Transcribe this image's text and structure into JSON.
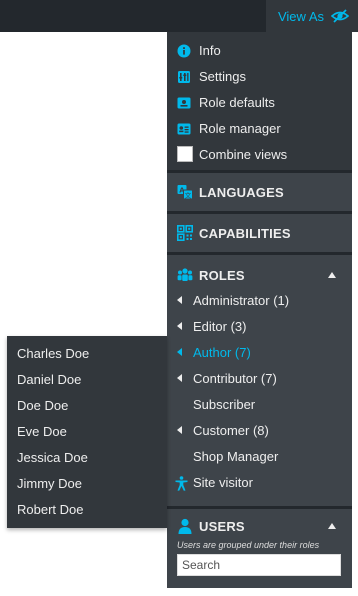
{
  "topbar": {
    "view_as_label": "View As",
    "view_as_icon": "eye-slash-icon",
    "accent": "#00b9eb"
  },
  "menu": {
    "items": [
      {
        "label": "Info",
        "icon": "info-icon"
      },
      {
        "label": "Settings",
        "icon": "settings-icon"
      },
      {
        "label": "Role defaults",
        "icon": "id-card-icon"
      },
      {
        "label": "Role manager",
        "icon": "id-card-alt-icon"
      },
      {
        "label": "Combine views",
        "icon": "checkbox"
      }
    ]
  },
  "sections": {
    "languages": {
      "title": "LANGUAGES",
      "icon": "translation-icon"
    },
    "capabilities": {
      "title": "CAPABILITIES",
      "icon": "capabilities-icon"
    },
    "roles": {
      "title": "ROLES",
      "icon": "groups-icon",
      "items": [
        {
          "label": "Administrator (1)",
          "has_arrow": true
        },
        {
          "label": "Editor (3)",
          "has_arrow": true
        },
        {
          "label": "Author (7)",
          "has_arrow": true,
          "active": true
        },
        {
          "label": "Contributor (7)",
          "has_arrow": true
        },
        {
          "label": "Subscriber",
          "has_arrow": false
        },
        {
          "label": "Customer (8)",
          "has_arrow": true
        },
        {
          "label": "Shop Manager",
          "has_arrow": false
        },
        {
          "label": "Site visitor",
          "icon": "universal-access-icon"
        }
      ]
    },
    "users": {
      "title": "USERS",
      "icon": "user-icon",
      "note": "Users are grouped under their roles",
      "search_placeholder": "Search"
    }
  },
  "submenu": {
    "users": [
      "Charles Doe",
      "Daniel Doe",
      "Doe Doe",
      "Eve Doe",
      "Jessica Doe",
      "Jimmy Doe",
      "Robert Doe"
    ]
  }
}
